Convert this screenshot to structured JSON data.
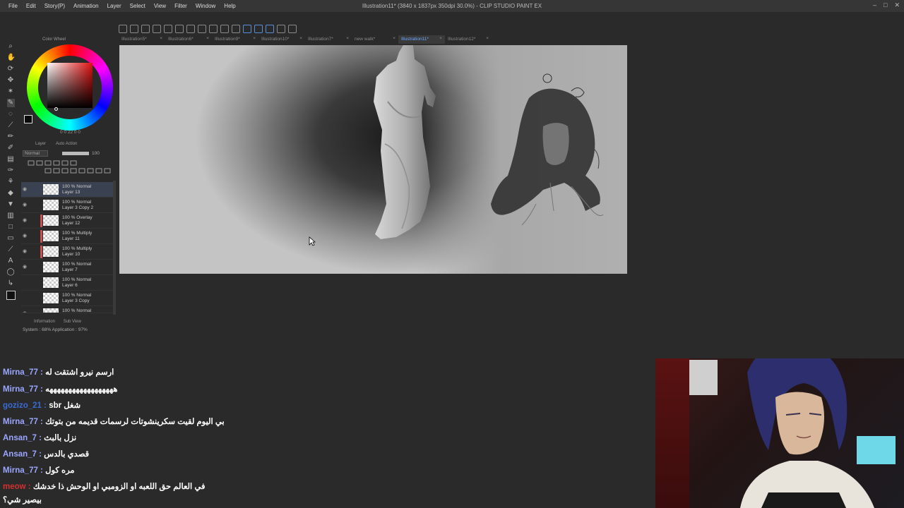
{
  "menu": {
    "items": [
      "File",
      "Edit",
      "Story(P)",
      "Animation",
      "Layer",
      "Select",
      "View",
      "Filter",
      "Window",
      "Help"
    ],
    "title": "Illustration11* (3840 x 1837px 350dpi 30.0%) - CLIP STUDIO PAINT EX"
  },
  "tabs": [
    {
      "label": "Illustration5*",
      "active": false
    },
    {
      "label": "Illustration6*",
      "active": false
    },
    {
      "label": "Illustration9*",
      "active": false
    },
    {
      "label": "Illustration10*",
      "active": false
    },
    {
      "label": "Illustration7*",
      "active": false
    },
    {
      "label": "new walk*",
      "active": false
    },
    {
      "label": "Illustration11*",
      "active": true
    },
    {
      "label": "Illustration12*",
      "active": false
    }
  ],
  "color_panel": {
    "title": "Color Wheel",
    "readout": "0  0  22  0  0"
  },
  "layer_panel": {
    "tabs": [
      "Layer",
      "Auto Action"
    ],
    "blend_mode": "Normal",
    "opacity": "100",
    "layers": [
      {
        "mode": "100 % Normal",
        "name": "Layer 13",
        "selected": true,
        "red": false
      },
      {
        "mode": "100 % Normal",
        "name": "Layer 3 Copy 2",
        "selected": false,
        "red": false
      },
      {
        "mode": "100 % Overlay",
        "name": "Layer 12",
        "selected": false,
        "red": true
      },
      {
        "mode": "100 % Multiply",
        "name": "Layer 11",
        "selected": false,
        "red": true
      },
      {
        "mode": "100 % Multiply",
        "name": "Layer 10",
        "selected": false,
        "red": true
      },
      {
        "mode": "100 % Normal",
        "name": "Layer 7",
        "selected": false,
        "red": false
      },
      {
        "mode": "100 % Normal",
        "name": "Layer 6",
        "selected": false,
        "red": false
      },
      {
        "mode": "100 % Normal",
        "name": "Layer 3 Copy",
        "selected": false,
        "red": false
      },
      {
        "mode": "100 % Normal",
        "name": "",
        "selected": false,
        "red": false
      }
    ]
  },
  "info_panel": {
    "tabs": [
      "Information",
      "Sub View"
    ],
    "system": "System : 68%  Application : 97%"
  },
  "chat": [
    {
      "user": "Mirna_77 :",
      "msg": "ارسم نيرو اشتقت له",
      "color": "purple"
    },
    {
      "user": "Mirna_77 :",
      "msg": "ههههههههههههههههههه",
      "color": "purple"
    },
    {
      "user": "gozizo_21 :",
      "msg": "sbr شغل",
      "color": "blue"
    },
    {
      "user": "Mirna_77 :",
      "msg": "بي اليوم لقيت سكرينشوتات لرسمات قديمه من بتوتك",
      "color": "purple"
    },
    {
      "user": "Ansan_7 :",
      "msg": "نزل بالبث",
      "color": "purple"
    },
    {
      "user": "Ansan_7 :",
      "msg": "قصدي بالدس",
      "color": "purple"
    },
    {
      "user": "Mirna_77 :",
      "msg": "مره كول",
      "color": "purple"
    },
    {
      "user": "meow :",
      "msg": "في العالم حق اللعبه او الزومبي او الوحش ذا خدشك",
      "color": "red"
    },
    {
      "user": "",
      "msg": "بيصير شي؟",
      "color": "white"
    }
  ]
}
